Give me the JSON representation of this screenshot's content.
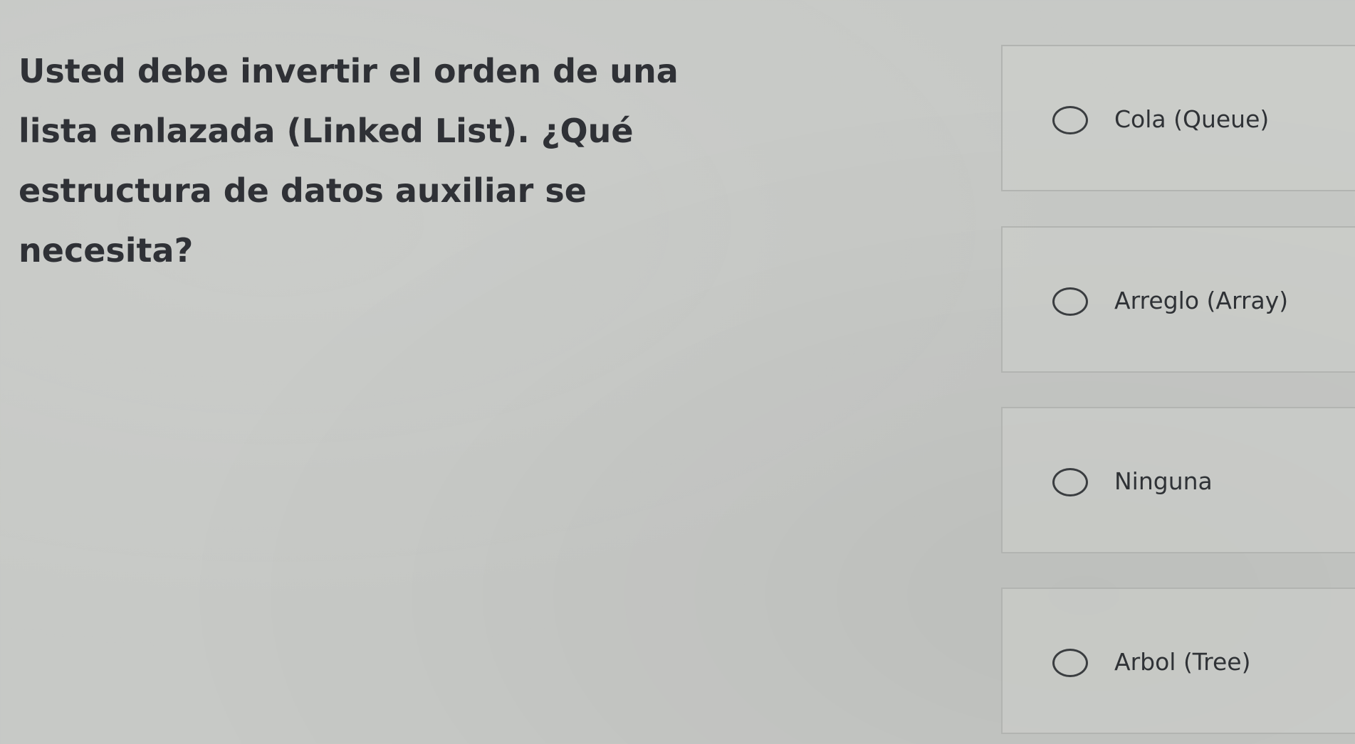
{
  "question": {
    "text": "Usted debe invertir el orden de una lista enlazada (Linked List). ¿Qué estructura de datos auxiliar se necesita?"
  },
  "options": [
    {
      "label": "Cola (Queue)",
      "selected": false
    },
    {
      "label": "Arreglo (Array)",
      "selected": false
    },
    {
      "label": "Ninguna",
      "selected": false
    },
    {
      "label": "Arbol (Tree)",
      "selected": false
    }
  ]
}
